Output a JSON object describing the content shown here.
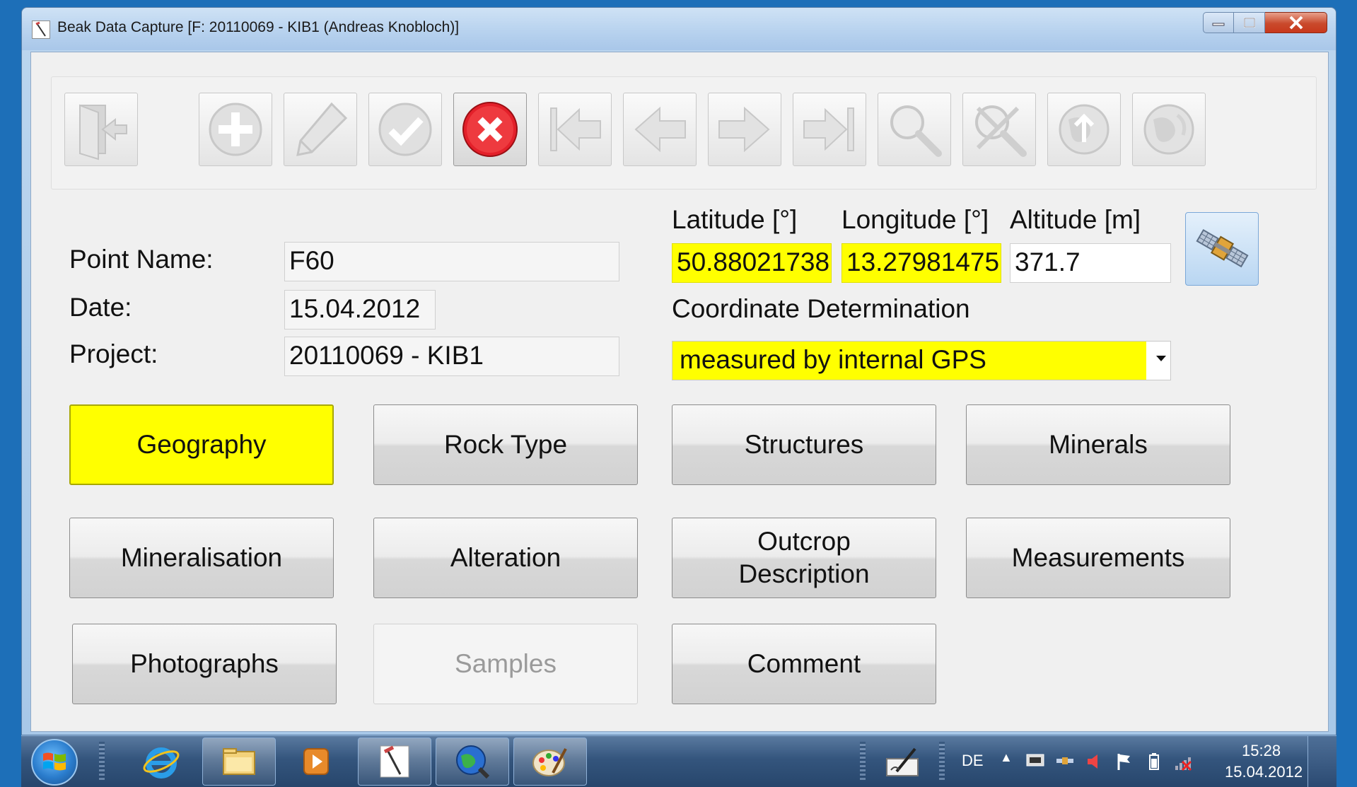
{
  "window": {
    "title": "Beak Data Capture [F: 20110069 - KIB1 (Andreas Knobloch)]",
    "controls": [
      "minimize",
      "maximize",
      "close"
    ]
  },
  "toolbar": {
    "buttons": [
      {
        "icon": "exit-door-icon",
        "state": "disabled"
      },
      {
        "icon": "plus-icon",
        "state": "disabled"
      },
      {
        "icon": "pencil-icon",
        "state": "disabled"
      },
      {
        "icon": "checkmark-icon",
        "state": "disabled"
      },
      {
        "icon": "cancel-icon",
        "state": "active",
        "color": "#e3202a"
      },
      {
        "icon": "first-record-icon",
        "state": "disabled"
      },
      {
        "icon": "previous-record-icon",
        "state": "disabled"
      },
      {
        "icon": "next-record-icon",
        "state": "disabled"
      },
      {
        "icon": "last-record-icon",
        "state": "disabled"
      },
      {
        "icon": "search-icon",
        "state": "disabled"
      },
      {
        "icon": "clear-search-icon",
        "state": "disabled"
      },
      {
        "icon": "globe-upload-icon",
        "state": "disabled"
      },
      {
        "icon": "globe-icon",
        "state": "disabled"
      }
    ]
  },
  "form": {
    "point_name_label": "Point Name:",
    "point_name_value": "F60",
    "date_label": "Date:",
    "date_value": "15.04.2012",
    "project_label": "Project:",
    "project_value": "20110069 - KIB1",
    "latitude_label": "Latitude [°]",
    "latitude_value": "50.88021738",
    "longitude_label": "Longitude [°]",
    "longitude_value": "13.27981475",
    "altitude_label": "Altitude [m]",
    "altitude_value": "371.7",
    "coord_det_label": "Coordinate Determination",
    "coord_det_value": "measured by internal GPS",
    "highlight_color": "#ffff00"
  },
  "categories": [
    {
      "label": "Geography",
      "state": "selected"
    },
    {
      "label": "Rock Type",
      "state": "normal"
    },
    {
      "label": "Structures",
      "state": "normal"
    },
    {
      "label": "Minerals",
      "state": "normal"
    },
    {
      "label": "Mineralisation",
      "state": "normal"
    },
    {
      "label": "Alteration",
      "state": "normal"
    },
    {
      "label": "Outcrop\nDescription",
      "state": "normal"
    },
    {
      "label": "Measurements",
      "state": "normal"
    },
    {
      "label": "Photographs",
      "state": "normal"
    },
    {
      "label": "Samples",
      "state": "disabled"
    },
    {
      "label": "Comment",
      "state": "normal"
    }
  ],
  "taskbar": {
    "apps": [
      "internet-explorer-icon",
      "file-explorer-icon",
      "media-player-icon",
      "beak-app-icon",
      "gis-globe-icon",
      "paint-icon"
    ],
    "language": "DE",
    "time": "15:28",
    "date": "15.04.2012"
  }
}
